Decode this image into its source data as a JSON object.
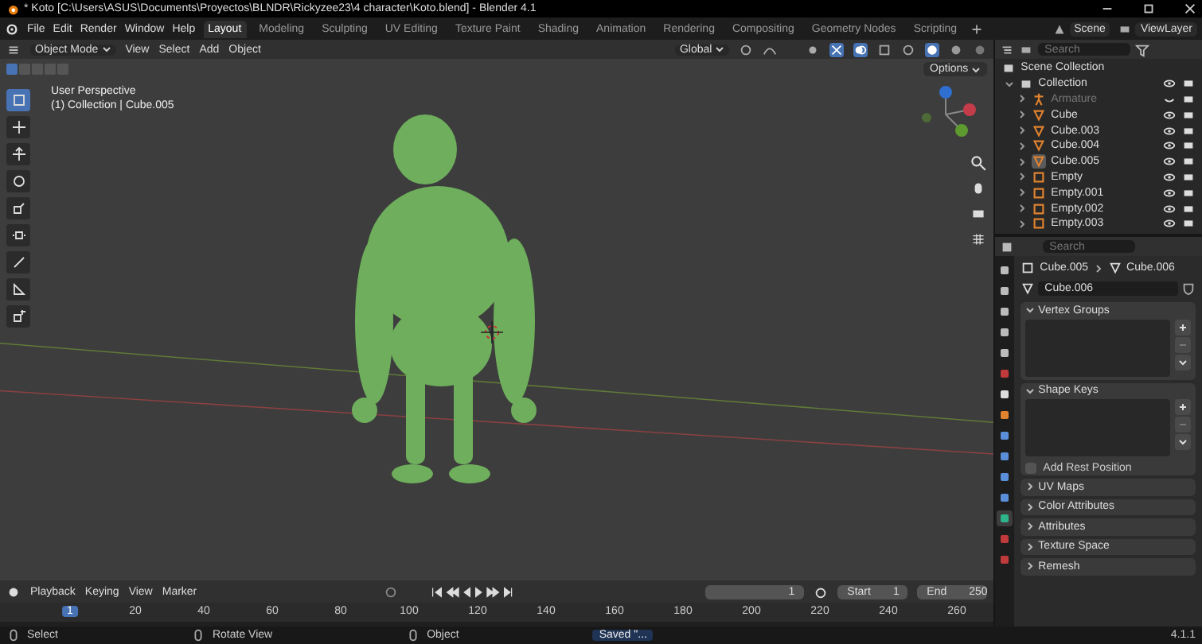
{
  "window": {
    "title": "* Koto [C:\\Users\\ASUS\\Documents\\Proyectos\\BLNDR\\Rickyzee23\\4 character\\Koto.blend] - Blender 4.1"
  },
  "menu": [
    "File",
    "Edit",
    "Render",
    "Window",
    "Help"
  ],
  "workspaces": [
    {
      "label": "Layout",
      "selected": true
    },
    {
      "label": "Modeling",
      "selected": false
    },
    {
      "label": "Sculpting",
      "selected": false
    },
    {
      "label": "UV Editing",
      "selected": false
    },
    {
      "label": "Texture Paint",
      "selected": false
    },
    {
      "label": "Shading",
      "selected": false
    },
    {
      "label": "Animation",
      "selected": false
    },
    {
      "label": "Rendering",
      "selected": false
    },
    {
      "label": "Compositing",
      "selected": false
    },
    {
      "label": "Geometry Nodes",
      "selected": false
    },
    {
      "label": "Scripting",
      "selected": false
    }
  ],
  "scene": "Scene",
  "view_layer": "ViewLayer",
  "viewport": {
    "mode": "Object Mode",
    "menus": [
      "View",
      "Select",
      "Add",
      "Object"
    ],
    "orientation": "Global",
    "options": "Options",
    "info": [
      "User Perspective",
      "(1) Collection | Cube.005"
    ],
    "tools": [
      {
        "kind": "select",
        "selected": true
      },
      {
        "kind": "cursor",
        "selected": false
      },
      {
        "kind": "move",
        "selected": false
      },
      {
        "kind": "rotate",
        "selected": false
      },
      {
        "kind": "scale",
        "selected": false
      },
      {
        "kind": "transform",
        "selected": false
      },
      {
        "kind": "annotate",
        "selected": false
      },
      {
        "kind": "measure",
        "selected": false
      },
      {
        "kind": "add",
        "selected": false
      }
    ]
  },
  "outliner": {
    "search": {
      "placeholder": "Search"
    },
    "root": "Scene Collection",
    "collection": {
      "name": "Collection",
      "expanded": true,
      "children": [
        {
          "name": "Armature",
          "kind": "armature",
          "hidden": true,
          "selected": false
        },
        {
          "name": "Cube",
          "kind": "mesh",
          "hidden": false,
          "selected": false
        },
        {
          "name": "Cube.003",
          "kind": "mesh",
          "hidden": false,
          "selected": false
        },
        {
          "name": "Cube.004",
          "kind": "mesh",
          "hidden": false,
          "selected": false
        },
        {
          "name": "Cube.005",
          "kind": "mesh",
          "hidden": false,
          "selected": true
        },
        {
          "name": "Empty",
          "kind": "empty",
          "hidden": false,
          "selected": false
        },
        {
          "name": "Empty.001",
          "kind": "empty",
          "hidden": false,
          "selected": false
        },
        {
          "name": "Empty.002",
          "kind": "empty",
          "hidden": false,
          "selected": false
        },
        {
          "name": "Empty.003",
          "kind": "empty",
          "hidden": false,
          "selected": false
        }
      ]
    }
  },
  "properties": {
    "search": {
      "placeholder": "Search"
    },
    "breadcrumb": [
      "Cube.005",
      "Cube.006"
    ],
    "mesh_name": "Cube.006",
    "tabs": [
      {
        "kind": "tool",
        "selected": false
      },
      {
        "kind": "render",
        "selected": false
      },
      {
        "kind": "output",
        "selected": false
      },
      {
        "kind": "view",
        "selected": false
      },
      {
        "kind": "scene",
        "selected": false
      },
      {
        "kind": "world",
        "selected": false
      },
      {
        "kind": "collection",
        "selected": false
      },
      {
        "kind": "object",
        "selected": false
      },
      {
        "kind": "modifiers",
        "selected": false
      },
      {
        "kind": "particles",
        "selected": false
      },
      {
        "kind": "physics",
        "selected": false
      },
      {
        "kind": "constraints",
        "selected": false
      },
      {
        "kind": "data",
        "selected": true
      },
      {
        "kind": "material",
        "selected": false
      },
      {
        "kind": "texture",
        "selected": false
      }
    ],
    "panels": [
      {
        "title": "Vertex Groups",
        "expanded": true
      },
      {
        "title": "Shape Keys",
        "expanded": true,
        "checkbox": {
          "label": "Add Rest Position",
          "checked": false
        }
      },
      {
        "title": "UV Maps",
        "expanded": false
      },
      {
        "title": "Color Attributes",
        "expanded": false
      },
      {
        "title": "Attributes",
        "expanded": false
      },
      {
        "title": "Texture Space",
        "expanded": false
      },
      {
        "title": "Remesh",
        "expanded": false
      }
    ]
  },
  "timeline": {
    "menus": [
      "Playback",
      "Keying",
      "View",
      "Marker"
    ],
    "current_frame": "1",
    "start_label": "Start",
    "start": "1",
    "end_label": "End",
    "end": "250",
    "ruler": [
      {
        "label": "1",
        "selected": true
      },
      {
        "label": "20",
        "selected": false
      },
      {
        "label": "40",
        "selected": false
      },
      {
        "label": "60",
        "selected": false
      },
      {
        "label": "80",
        "selected": false
      },
      {
        "label": "100",
        "selected": false
      },
      {
        "label": "120",
        "selected": false
      },
      {
        "label": "140",
        "selected": false
      },
      {
        "label": "160",
        "selected": false
      },
      {
        "label": "180",
        "selected": false
      },
      {
        "label": "200",
        "selected": false
      },
      {
        "label": "220",
        "selected": false
      },
      {
        "label": "240",
        "selected": false
      },
      {
        "label": "260",
        "selected": false
      }
    ]
  },
  "status_bar": {
    "hints": [
      "Select",
      "Rotate View",
      "Object"
    ],
    "notice": "Saved \"...",
    "version": "4.1.1"
  }
}
